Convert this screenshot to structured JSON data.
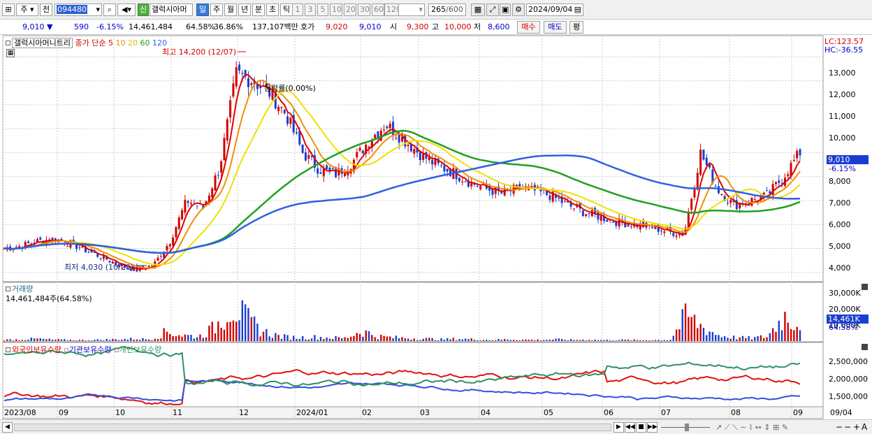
{
  "toolbar": {
    "market": "주",
    "prev_label": "전",
    "code": "094480",
    "new_badge": "신",
    "stock_name": "갤럭시아머",
    "periods": [
      "일",
      "주",
      "월",
      "년",
      "분",
      "초",
      "틱"
    ],
    "active_period": "일",
    "intervals": [
      "1",
      "3",
      "5",
      "10",
      "20",
      "30",
      "60",
      "120"
    ],
    "count": "265",
    "count_total": "/600",
    "date": "2024/09/04"
  },
  "quote": {
    "price": "9,010",
    "change_arrow": "▼",
    "change": "590",
    "change_pct": "-6.15%",
    "volume": "14,461,484",
    "vol_ratio": "64.58%",
    "turnover": "36.86%",
    "amount": "137,107백만",
    "bid_label": "호가",
    "bid": "9,020",
    "ask": "9,010",
    "open_label": "시",
    "open": "9,300",
    "high_label": "고",
    "high": "10,000",
    "low_label": "저",
    "low": "8,600",
    "buy": "매수",
    "sell": "매도",
    "eval": "평"
  },
  "price_panel": {
    "title": "갤럭시아머니트리",
    "ma_label": "종가 단순",
    "ma_periods": [
      "5",
      "10",
      "20",
      "60",
      "120"
    ],
    "max_note": "최고 14,200 (12/07)",
    "min_note": "최저 4,030 (10/20)",
    "rate_note": "등락률(0.00%)",
    "lc": "LC:123.57",
    "hc": "HC:-36.55",
    "y_ticks": [
      "13,000",
      "12,000",
      "11,000",
      "10,000",
      "9,000",
      "8,000",
      "7,000",
      "6,000",
      "5,000",
      "4,000"
    ],
    "last_price": "9,010",
    "last_change": "-6.15%"
  },
  "volume_panel": {
    "title": "거래량",
    "subtitle": "14,461,484주(64.58%)",
    "y_ticks": [
      "30,000K",
      "20,000K",
      "10,000K"
    ],
    "last": "14,461K",
    "last_pct": "64.58%"
  },
  "holding_panel": {
    "series": [
      "외국인보유수량",
      "기관보유수량",
      "개인보유수량"
    ],
    "y_ticks": [
      "2,500,000",
      "2,000,000",
      "1,500,000"
    ]
  },
  "x_axis": [
    "2023/08",
    "09",
    "10",
    "11",
    "12",
    "2024/01",
    "02",
    "03",
    "04",
    "05",
    "06",
    "07",
    "08",
    "09",
    "09/04"
  ],
  "colors": {
    "up": "#d00000",
    "down": "#1a3fd0",
    "ma5": "#e00000",
    "ma10": "#f09000",
    "ma20": "#f0e000",
    "ma60": "#20a020",
    "ma120": "#3060e0",
    "foreign": "#e01010",
    "inst": "#3050e0",
    "retail": "#309060"
  },
  "chart_data": {
    "type": "candlestick",
    "months": [
      "2023/08",
      "09",
      "10",
      "11",
      "12",
      "2024/01",
      "02",
      "03",
      "04",
      "05",
      "06",
      "07",
      "08",
      "09"
    ],
    "price_range": [
      3700,
      13800
    ],
    "close": [
      5000,
      5100,
      5300,
      5400,
      5200,
      4900,
      4600,
      4300,
      4100,
      4300,
      5300,
      7000,
      6700,
      8400,
      12300,
      12000,
      11500,
      10600,
      9000,
      8300,
      8100,
      8600,
      9500,
      10200,
      9600,
      9000,
      8500,
      8200,
      7800,
      7500,
      7300,
      7500,
      7400,
      7200,
      6800,
      6500,
      6300,
      6100,
      6000,
      5900,
      5700,
      5600,
      9000,
      7500,
      6800,
      7000,
      7200,
      8000,
      9010
    ],
    "volume_peak_k": [
      1000,
      1500,
      2000,
      1200,
      1000,
      800,
      1200,
      1500,
      2000,
      1500,
      8000,
      5000,
      4000,
      12000,
      32000,
      18000,
      8000,
      4000,
      3000,
      3500,
      3000,
      2500,
      9000,
      4000,
      3000,
      2500,
      2000,
      1500,
      2000,
      1500,
      1000,
      1500,
      1200,
      1000,
      1500,
      1000,
      1200,
      800,
      1000,
      800,
      900,
      1000,
      22000,
      12000,
      5000,
      3000,
      2500,
      4000,
      22000,
      14461
    ],
    "volume_range_k": [
      0,
      34000
    ],
    "holding_range": [
      1300000,
      2800000
    ]
  }
}
